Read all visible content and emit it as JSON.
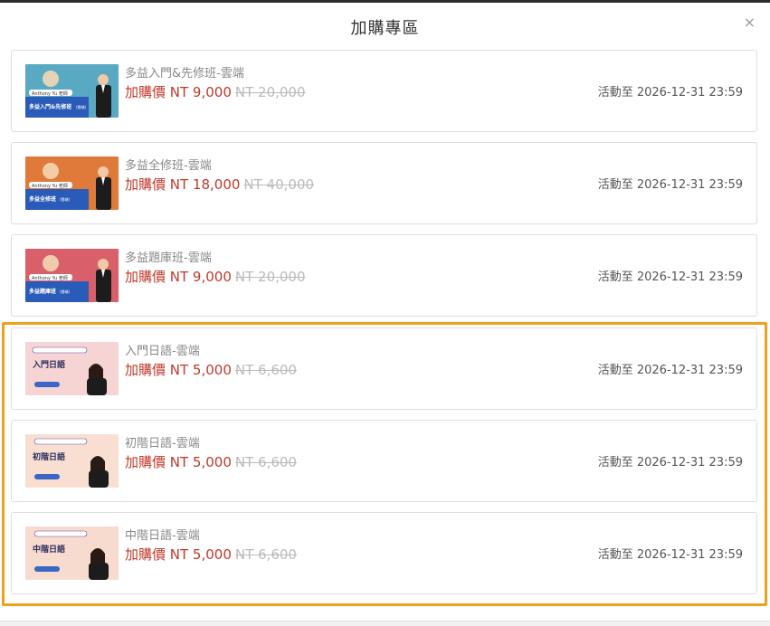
{
  "modal": {
    "title": "加購專區",
    "close_label": "×"
  },
  "products": [
    {
      "name": "多益入門&先修班-雲端",
      "price": "加購價 NT 9,000",
      "original_price": "NT 20,000",
      "deadline": "活動至 2026-12-31 23:59",
      "thumb": {
        "bg": "#5aa9c2",
        "banner": "#2b5bb8",
        "badge": "Anthony Yu 老師",
        "caption": "多益入門&先修班",
        "tag": "(雲端)"
      }
    },
    {
      "name": "多益全修班-雲端",
      "price": "加購價 NT 18,000",
      "original_price": "NT 40,000",
      "deadline": "活動至 2026-12-31 23:59",
      "thumb": {
        "bg": "#e07a3a",
        "banner": "#2b5bb8",
        "badge": "Anthony Yu 老師",
        "caption": "多益全修班",
        "tag": "(雲端)"
      }
    },
    {
      "name": "多益題庫班-雲端",
      "price": "加購價 NT 9,000",
      "original_price": "NT 20,000",
      "deadline": "活動至 2026-12-31 23:59",
      "thumb": {
        "bg": "#d9606a",
        "banner": "#2b5bb8",
        "badge": "Anthony Yu 老師",
        "caption": "多益題庫班",
        "tag": "(雲端)"
      }
    },
    {
      "name": "入門日語-雲端",
      "price": "加購價 NT 5,000",
      "original_price": "NT 6,600",
      "deadline": "活動至 2026-12-31 23:59",
      "thumb": {
        "bg": "#f5c6c6",
        "banner": "#f7dede",
        "caption": "入門日語"
      }
    },
    {
      "name": "初階日語-雲端",
      "price": "加購價 NT 5,000",
      "original_price": "NT 6,600",
      "deadline": "活動至 2026-12-31 23:59",
      "thumb": {
        "bg": "#f8d9c8",
        "banner": "#f7e6dc",
        "caption": "初階日語"
      }
    },
    {
      "name": "中階日語-雲端",
      "price": "加購價 NT 5,000",
      "original_price": "NT 6,600",
      "deadline": "活動至 2026-12-31 23:59",
      "thumb": {
        "bg": "#f6d4c4",
        "banner": "#f7e2d8",
        "caption": "中階日語"
      }
    }
  ],
  "colors": {
    "price": "#c0392b",
    "highlight": "#f0a11c"
  }
}
